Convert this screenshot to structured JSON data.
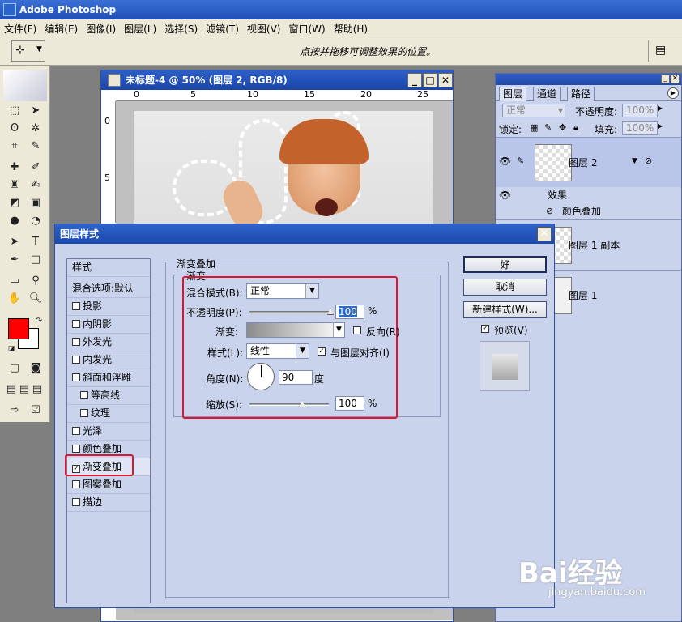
{
  "app": {
    "title": "Adobe Photoshop"
  },
  "menu": [
    "文件(F)",
    "编辑(E)",
    "图像(I)",
    "图层(L)",
    "选择(S)",
    "滤镜(T)",
    "视图(V)",
    "窗口(W)",
    "帮助(H)"
  ],
  "options_bar": {
    "hint": "点按并拖移可调整效果的位置。"
  },
  "document": {
    "title": "未标题-4 @ 50% (图层 2, RGB/8)",
    "ruler_h": [
      "0",
      "5",
      "10",
      "15",
      "20",
      "25"
    ],
    "ruler_v": [
      "0",
      "5"
    ]
  },
  "colors": {
    "foreground": "#ff0000",
    "background": "#ffffff",
    "highlight": "#e0152d"
  },
  "layers_panel": {
    "tabs": [
      "图层",
      "通道",
      "路径"
    ],
    "blend_mode": "正常",
    "opacity_label": "不透明度:",
    "opacity_value": "100%",
    "lock_label": "锁定:",
    "fill_label": "填充:",
    "fill_value": "100%",
    "layers": [
      {
        "name": "图层 2"
      },
      {
        "name": "图层 1 副本"
      },
      {
        "name": "图层 1"
      }
    ],
    "effects_label": "效果",
    "effect_item": "颜色叠加"
  },
  "dialog": {
    "title": "图层样式",
    "style_list": [
      {
        "label": "样式",
        "checkbox": false
      },
      {
        "label": "混合选项:默认",
        "checkbox": false
      },
      {
        "label": "投影",
        "checkbox": true,
        "checked": false
      },
      {
        "label": "内阴影",
        "checkbox": true,
        "checked": false
      },
      {
        "label": "外发光",
        "checkbox": true,
        "checked": false
      },
      {
        "label": "内发光",
        "checkbox": true,
        "checked": false
      },
      {
        "label": "斜面和浮雕",
        "checkbox": true,
        "checked": false
      },
      {
        "label": "等高线",
        "checkbox": true,
        "checked": false,
        "indent": true
      },
      {
        "label": "纹理",
        "checkbox": true,
        "checked": false,
        "indent": true
      },
      {
        "label": "光泽",
        "checkbox": true,
        "checked": false
      },
      {
        "label": "颜色叠加",
        "checkbox": true,
        "checked": false
      },
      {
        "label": "渐变叠加",
        "checkbox": true,
        "checked": true,
        "active": true
      },
      {
        "label": "图案叠加",
        "checkbox": true,
        "checked": false
      },
      {
        "label": "描边",
        "checkbox": true,
        "checked": false
      }
    ],
    "section_title": "渐变叠加",
    "subsection_title": "渐变",
    "blend_mode_label": "混合模式(B):",
    "blend_mode_value": "正常",
    "opacity_label": "不透明度(P):",
    "opacity_value": "100",
    "opacity_percent": 100,
    "percent_sign": "%",
    "gradient_label": "渐变:",
    "reverse_label": "反向(R)",
    "style_label": "样式(L):",
    "style_value": "线性",
    "align_label": "与图层对齐(I)",
    "angle_label": "角度(N):",
    "angle_value": "90",
    "degree_label": "度",
    "scale_label": "缩放(S):",
    "scale_value": "100",
    "scale_percent": 100,
    "buttons": {
      "ok": "好",
      "cancel": "取消",
      "new_style": "新建样式(W)..."
    },
    "preview_label": "预览(V)"
  },
  "watermark": {
    "text": "Bai经验",
    "sub": "jingyan.baidu.com"
  }
}
